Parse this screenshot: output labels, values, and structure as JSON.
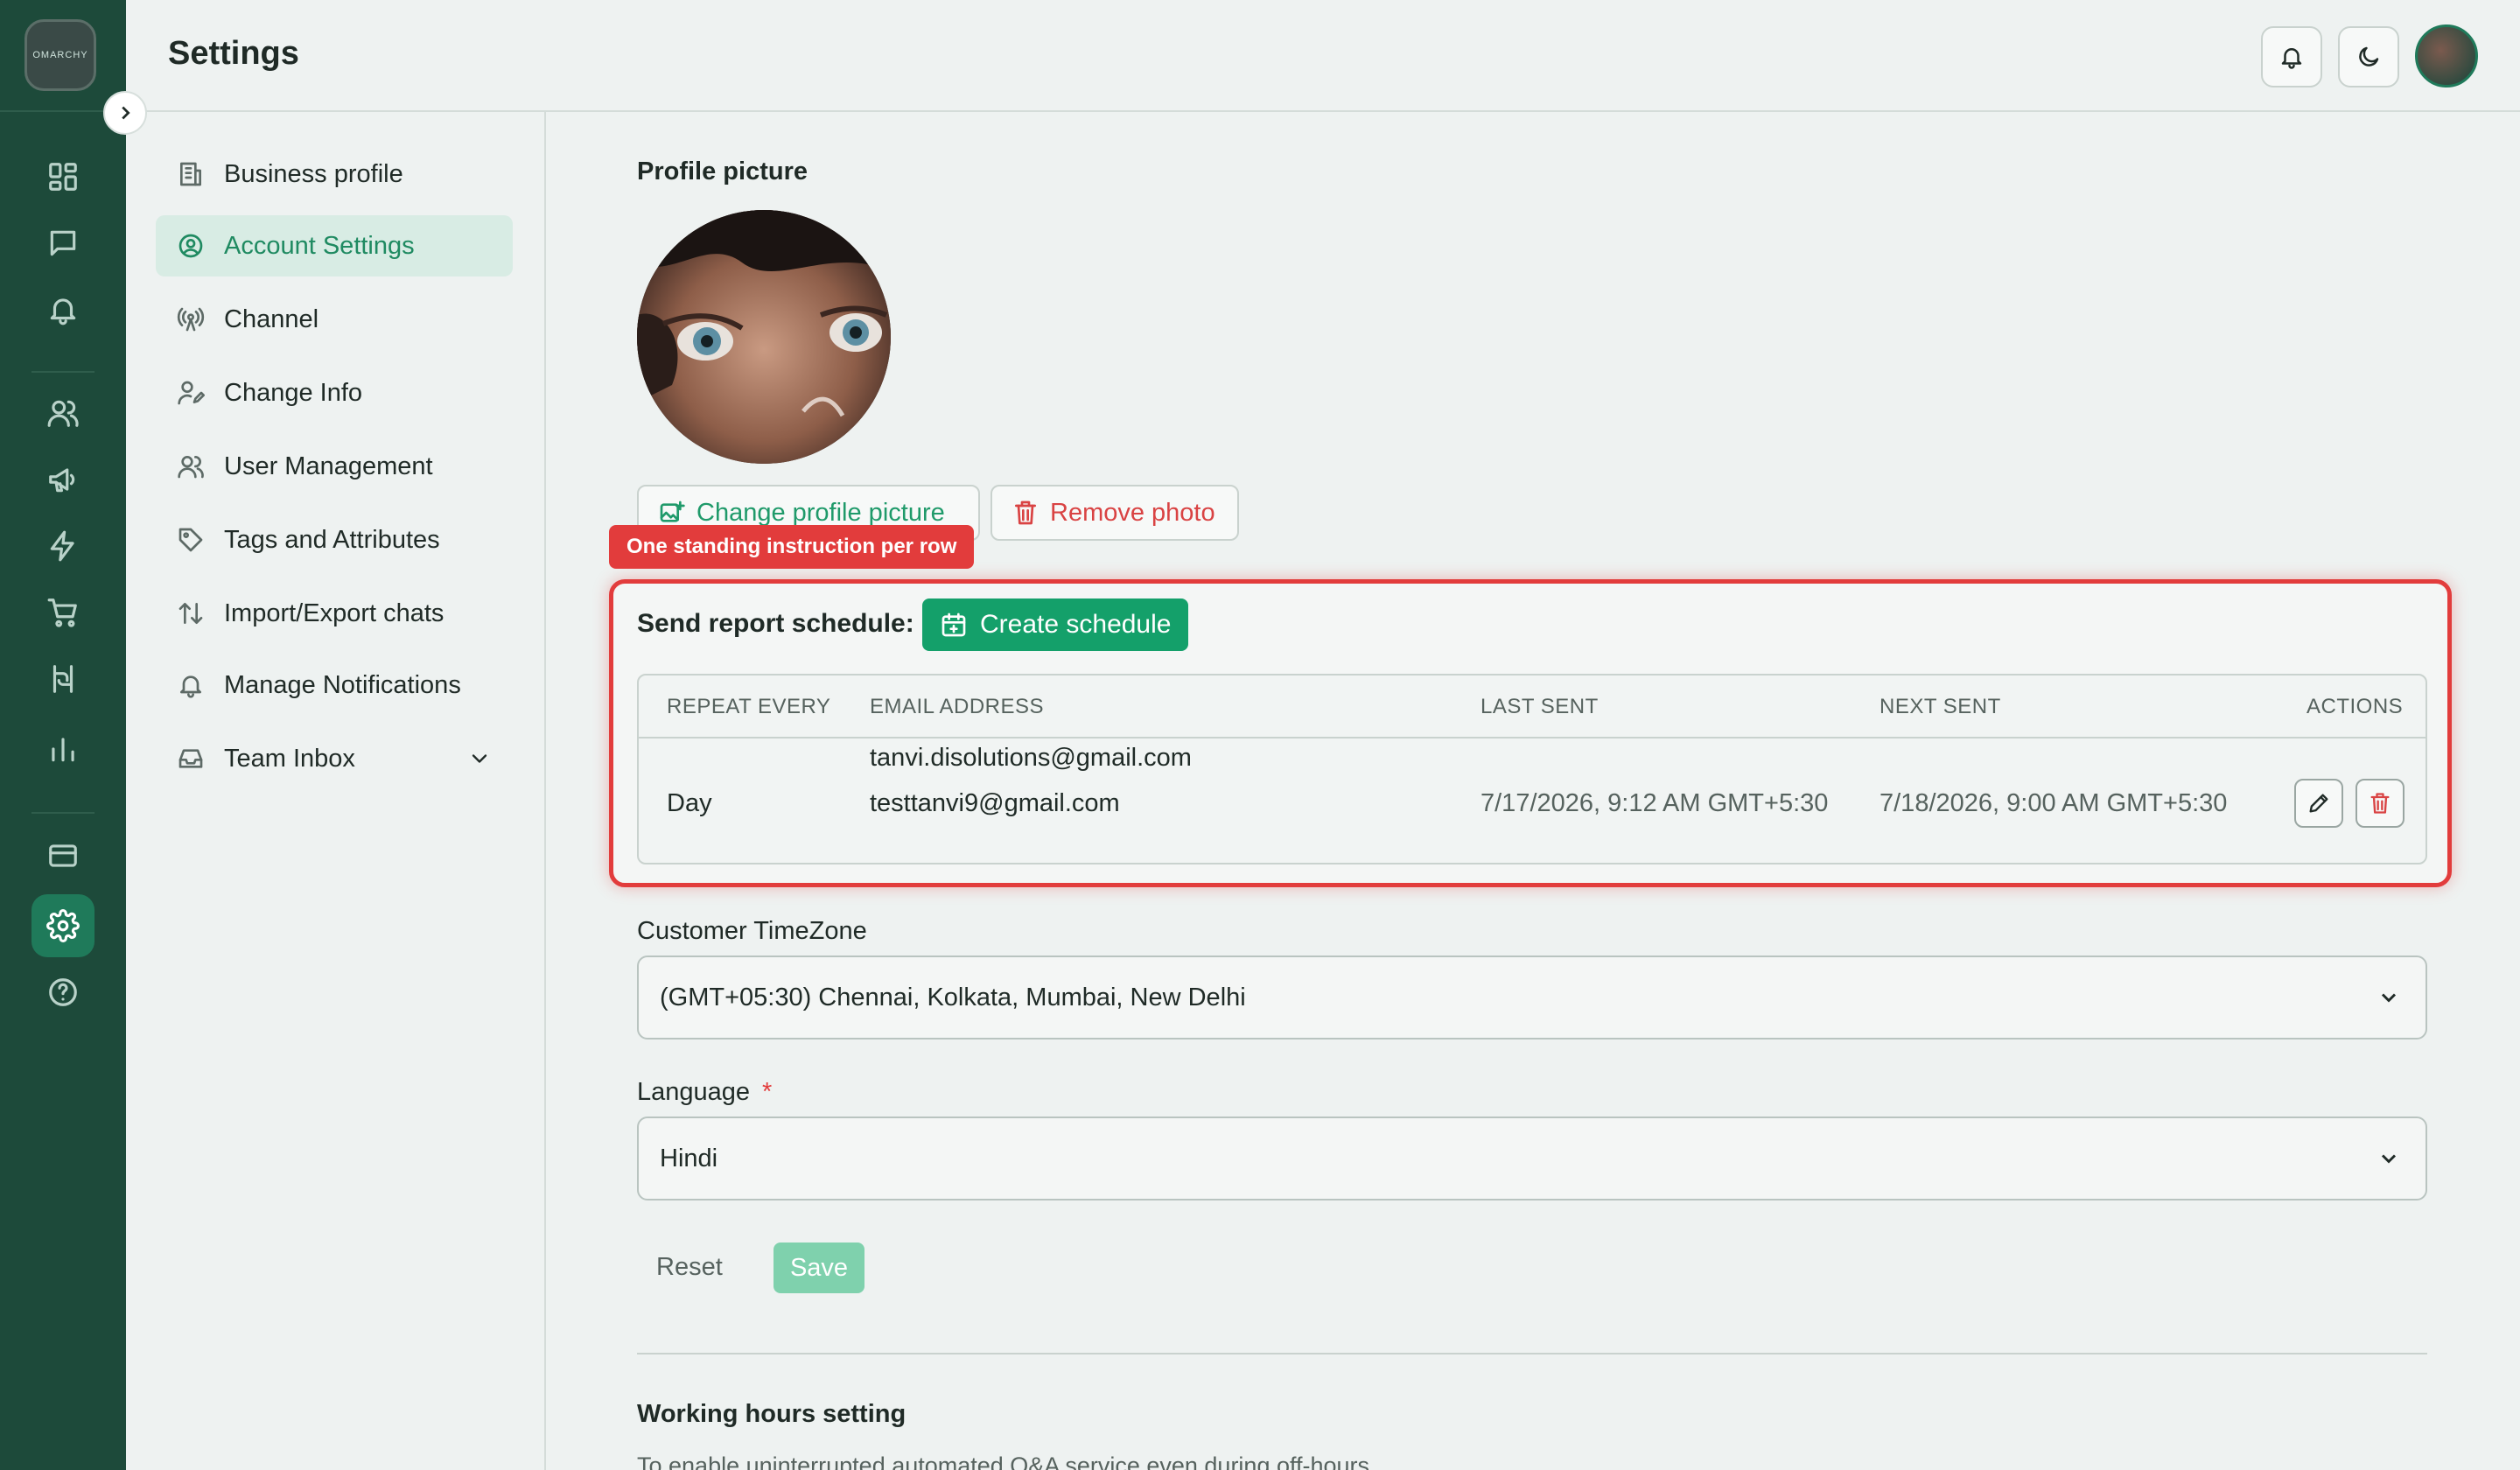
{
  "app": {
    "logo_text": "OMARCHY",
    "page_title": "Settings"
  },
  "colors": {
    "brand": "#1d4a3a",
    "accent": "#14a06a",
    "danger": "#e23c3c"
  },
  "rail": {
    "icons": [
      "dashboard-icon",
      "chat-icon",
      "bell-icon",
      "users-icon",
      "megaphone-icon",
      "bolt-icon",
      "cart-icon",
      "flow-icon",
      "chart-icon",
      "card-icon",
      "gear-icon",
      "help-icon"
    ],
    "active": "gear-icon"
  },
  "sidebar": {
    "items": [
      {
        "label": "Business profile",
        "icon": "building-icon"
      },
      {
        "label": "Account Settings",
        "icon": "user-circle-icon",
        "active": true
      },
      {
        "label": "Channel",
        "icon": "antenna-icon"
      },
      {
        "label": "Change Info",
        "icon": "user-edit-icon"
      },
      {
        "label": "User Management",
        "icon": "users-icon"
      },
      {
        "label": "Tags and Attributes",
        "icon": "tag-icon"
      },
      {
        "label": "Import/Export chats",
        "icon": "arrows-updown-icon"
      },
      {
        "label": "Manage Notifications",
        "icon": "bell-icon"
      },
      {
        "label": "Team Inbox",
        "icon": "inbox-icon"
      }
    ]
  },
  "profile": {
    "title": "Profile picture",
    "change_label": "Change profile picture",
    "remove_label": "Remove photo"
  },
  "annotation": {
    "tag": "One standing instruction per row"
  },
  "schedule": {
    "label": "Send report schedule:",
    "create_label": "Create schedule",
    "columns": [
      "REPEAT EVERY",
      "EMAIL ADDRESS",
      "LAST SENT",
      "NEXT SENT",
      "ACTIONS"
    ],
    "rows": [
      {
        "repeat": "Day",
        "emails": [
          "tanvi.disolutions@gmail.com",
          "testtanvi9@gmail.com"
        ],
        "last_sent": "7/17/2026, 9:12 AM GMT+5:30",
        "next_sent": "7/18/2026, 9:00 AM GMT+5:30"
      }
    ]
  },
  "timezone": {
    "label": "Customer TimeZone",
    "value": "(GMT+05:30) Chennai, Kolkata, Mumbai, New Delhi"
  },
  "language": {
    "label": "Language",
    "required_mark": "*",
    "value": "Hindi"
  },
  "form": {
    "reset_label": "Reset",
    "save_label": "Save"
  },
  "working_hours": {
    "title": "Working hours setting",
    "desc": "To enable uninterrupted automated Q&A service even during off-hours"
  }
}
